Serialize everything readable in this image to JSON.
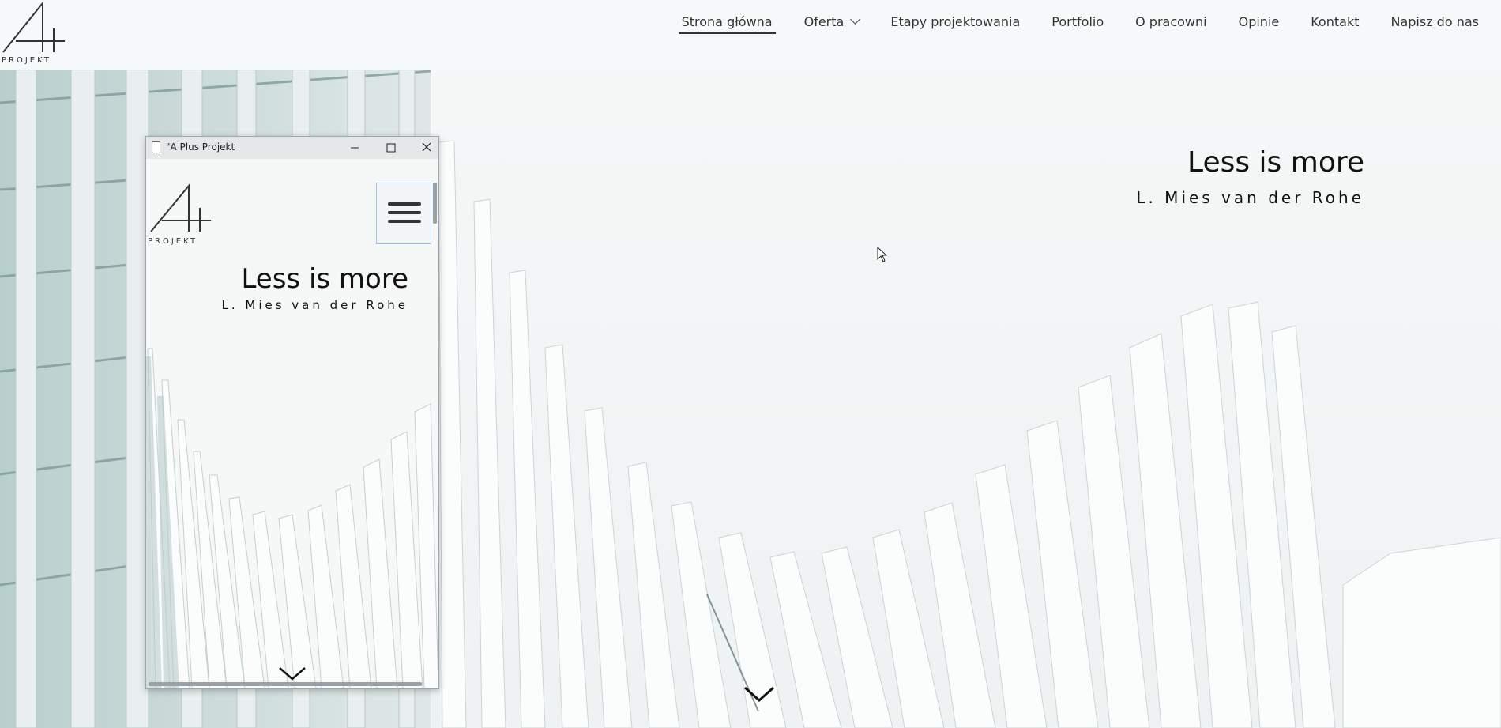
{
  "brand": {
    "logo_text": "PROJEKT"
  },
  "nav": {
    "items": [
      {
        "label": "Strona główna",
        "active": true
      },
      {
        "label": "Oferta",
        "has_dropdown": true
      },
      {
        "label": "Etapy projektowania"
      },
      {
        "label": "Portfolio"
      },
      {
        "label": "O pracowni"
      },
      {
        "label": "Opinie"
      },
      {
        "label": "Kontakt"
      },
      {
        "label": "Napisz do nas"
      }
    ]
  },
  "hero": {
    "quote": "Less is more",
    "author": "L. Mies van der Rohe",
    "scroll_icon": "chevron-down-icon"
  },
  "popup_window": {
    "title": "\"A Plus Projekt",
    "logo_text": "PROJEKT",
    "quote": "Less is more",
    "author": "L. Mies van der Rohe",
    "menu_icon": "hamburger-icon"
  },
  "colors": {
    "text": "#111111",
    "nav_text": "#333333",
    "background": "#f4f6f6",
    "glass_tint": "#a8c2c0"
  }
}
